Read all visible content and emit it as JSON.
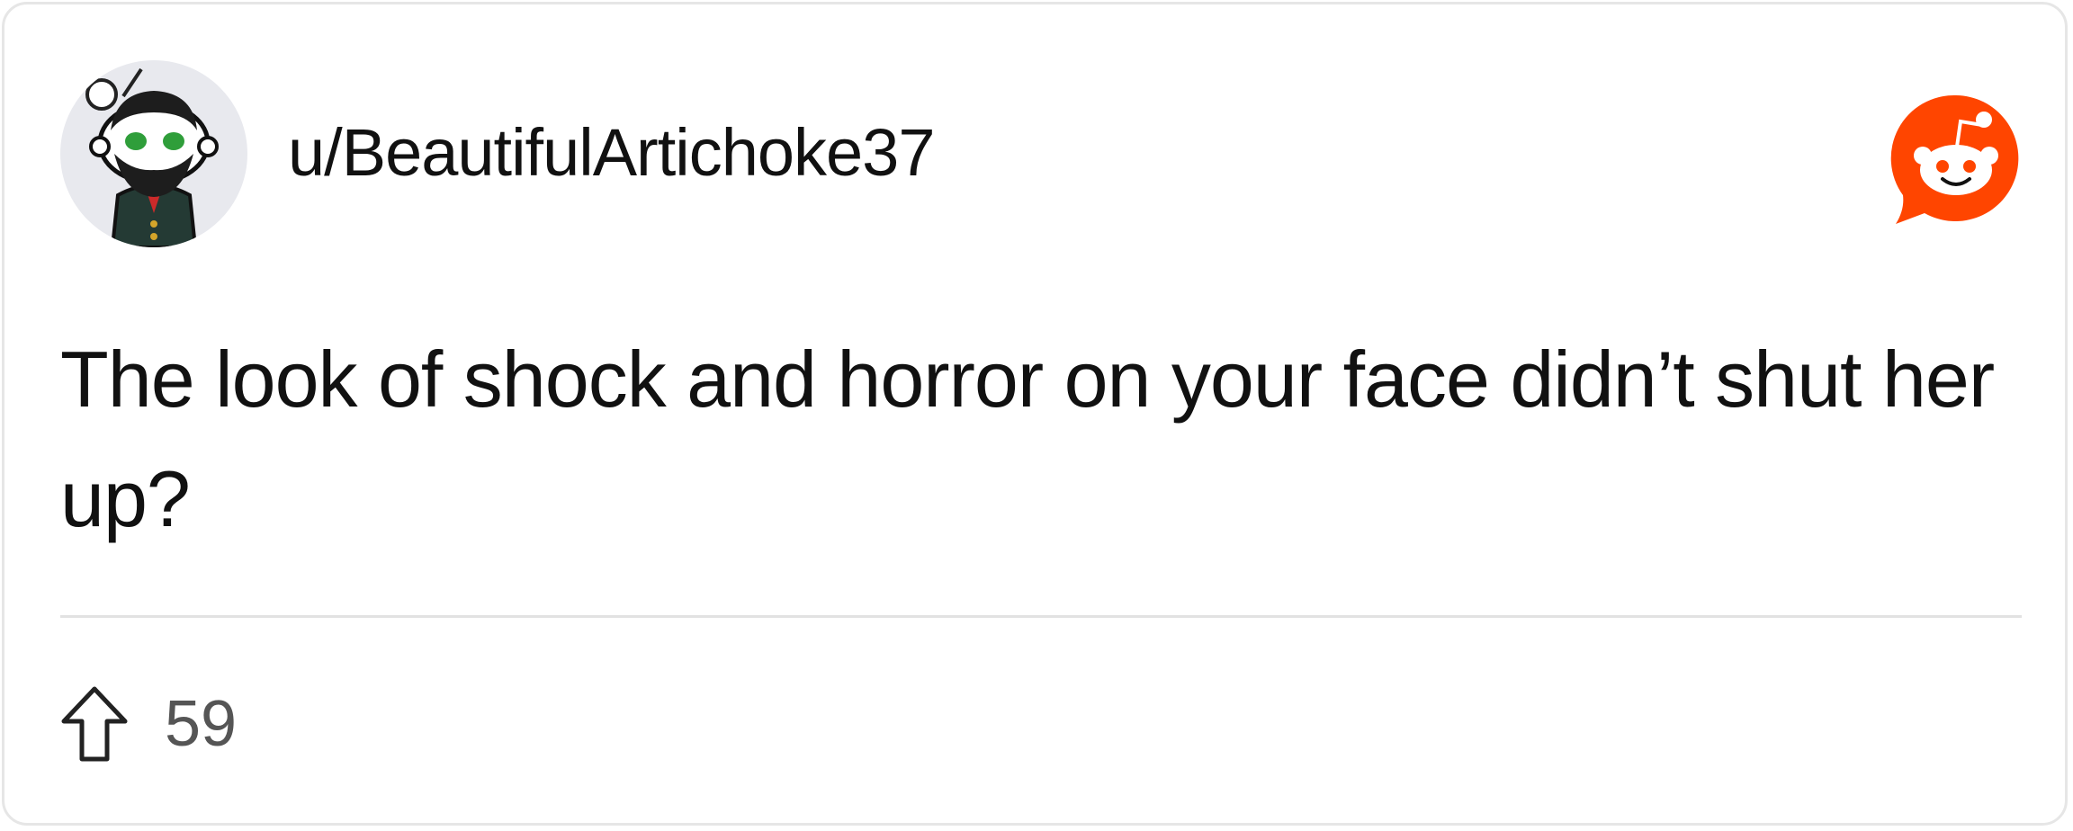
{
  "post": {
    "username": "u/BeautifulArtichoke37",
    "avatar_icon": "snoo-avatar-icon",
    "brand_icon": "reddit-logo-icon",
    "body": "The look of shock and horror on your face didn’t shut her up?",
    "upvote_icon": "upvote-arrow-icon",
    "upvotes": "59"
  },
  "colors": {
    "reddit_orange": "#ff4500",
    "text": "#111111",
    "muted": "#555555",
    "border": "#e6e6e6"
  }
}
